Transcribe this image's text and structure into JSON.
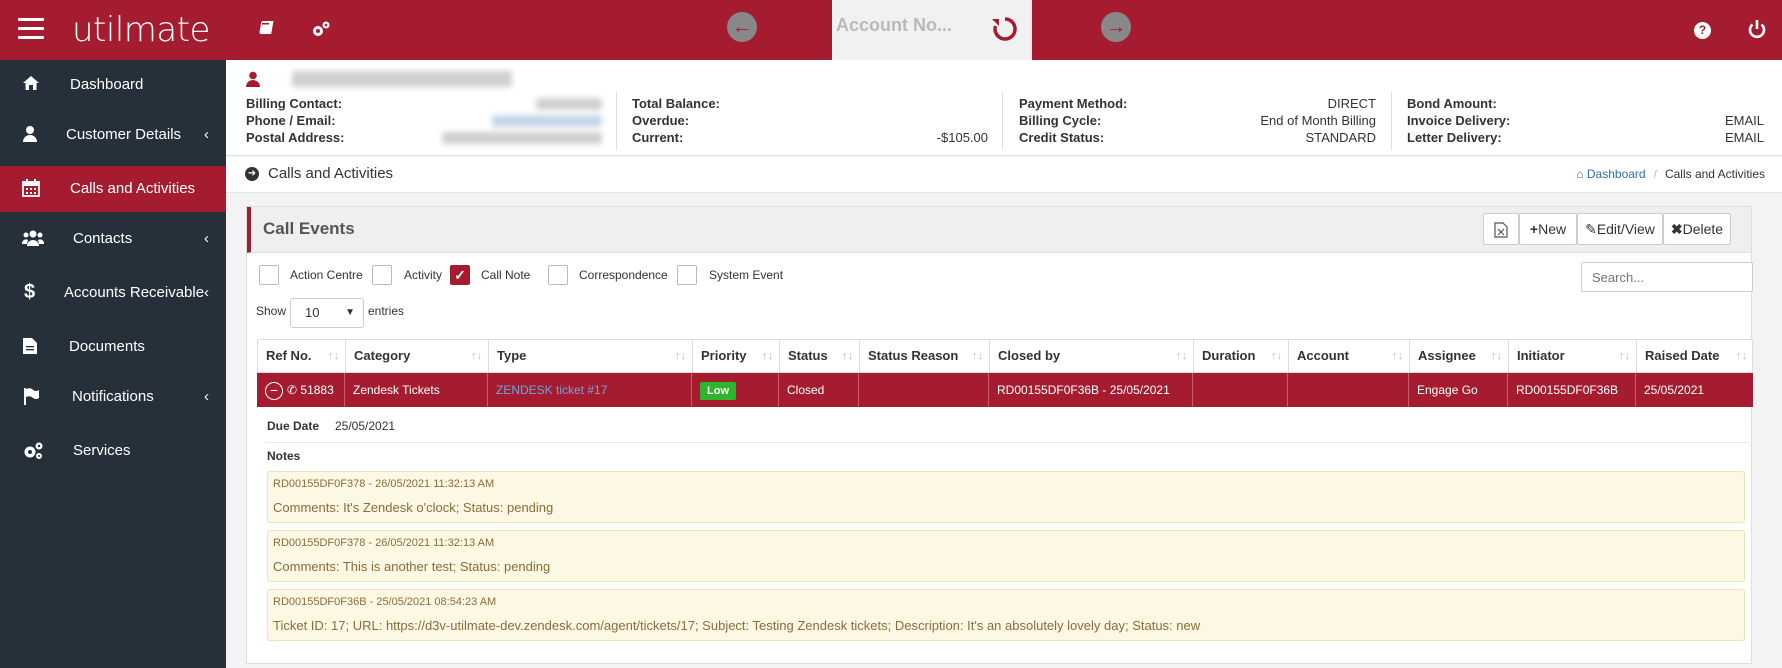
{
  "app": {
    "logo": "utilmate",
    "account_tab_label": "Account No..."
  },
  "sidebar": {
    "items": [
      {
        "label": "Dashboard",
        "icon": "home-icon",
        "has_submenu": false,
        "active": false
      },
      {
        "label": "Customer Details",
        "icon": "user-icon",
        "has_submenu": true,
        "active": false
      },
      {
        "label": "Calls and Activities",
        "icon": "calendar-icon",
        "has_submenu": false,
        "active": true
      },
      {
        "label": "Contacts",
        "icon": "users-icon",
        "has_submenu": true,
        "active": false
      },
      {
        "label": "Accounts Receivable",
        "icon": "dollar-icon",
        "has_submenu": true,
        "active": false
      },
      {
        "label": "Documents",
        "icon": "document-icon",
        "has_submenu": false,
        "active": false
      },
      {
        "label": "Notifications",
        "icon": "flag-icon",
        "has_submenu": true,
        "active": false
      },
      {
        "label": "Services",
        "icon": "cogs-icon",
        "has_submenu": false,
        "active": false
      }
    ]
  },
  "customer": {
    "billing_contact_label": "Billing Contact:",
    "phone_email_label": "Phone / Email:",
    "postal_address_label": "Postal Address:",
    "total_balance_label": "Total Balance:",
    "overdue_label": "Overdue:",
    "current_label": "Current:",
    "current_value": "-$105.00",
    "payment_method_label": "Payment Method:",
    "payment_method_value": "DIRECT",
    "billing_cycle_label": "Billing Cycle:",
    "billing_cycle_value": "End of Month Billing",
    "credit_status_label": "Credit Status:",
    "credit_status_value": "STANDARD",
    "bond_amount_label": "Bond Amount:",
    "invoice_delivery_label": "Invoice Delivery:",
    "invoice_delivery_value": "EMAIL",
    "letter_delivery_label": "Letter Delivery:",
    "letter_delivery_value": "EMAIL"
  },
  "page": {
    "title": "Calls and Activities",
    "breadcrumb": {
      "home": "Dashboard",
      "current": "Calls and Activities"
    }
  },
  "panel": {
    "title": "Call Events",
    "buttons": {
      "new": "New",
      "edit": "Edit/View",
      "delete": "Delete"
    },
    "filters": [
      {
        "label": "Action Centre",
        "checked": false
      },
      {
        "label": "Activity",
        "checked": false
      },
      {
        "label": "Call Note",
        "checked": true
      },
      {
        "label": "Correspondence",
        "checked": false
      },
      {
        "label": "System Event",
        "checked": false
      }
    ],
    "search_placeholder": "Search...",
    "show_label": "Show",
    "entries_value": "10",
    "entries_label": "entries"
  },
  "table": {
    "columns": [
      "Ref No.",
      "Category",
      "Type",
      "Priority",
      "Status",
      "Status Reason",
      "Closed by",
      "Duration",
      "Account",
      "Assignee",
      "Initiator",
      "Raised Date"
    ],
    "row": {
      "ref_no": "51883",
      "category": "Zendesk Tickets",
      "type": "ZENDESK ticket #17",
      "priority": "Low",
      "status": "Closed",
      "status_reason": "",
      "closed_by": "RD00155DF0F36B - 25/05/2021",
      "duration": "",
      "account": "",
      "assignee": "Engage Go",
      "initiator": "RD00155DF0F36B",
      "raised_date": "25/05/2021"
    },
    "detail": {
      "due_date_label": "Due Date",
      "due_date_value": "25/05/2021",
      "notes_label": "Notes",
      "notes": [
        {
          "meta": "RD00155DF0F378 - 26/05/2021 11:32:13 AM",
          "text": "Comments: It's Zendesk o'clock; Status: pending"
        },
        {
          "meta": "RD00155DF0F378 - 26/05/2021 11:32:13 AM",
          "text": "Comments: This is another test; Status: pending"
        },
        {
          "meta": "RD00155DF0F36B - 25/05/2021 08:54:23 AM",
          "text": "Ticket ID: 17; URL: https://d3v-utilmate-dev.zendesk.com/agent/tickets/17; Subject: Testing Zendesk tickets; Description: It's an absolutely lovely day; Status: new"
        }
      ]
    }
  },
  "colors": {
    "brand": "#a51c30",
    "sidebar": "#25303b",
    "note_bg": "#fcf8e3",
    "priority_low": "#2db52d"
  }
}
